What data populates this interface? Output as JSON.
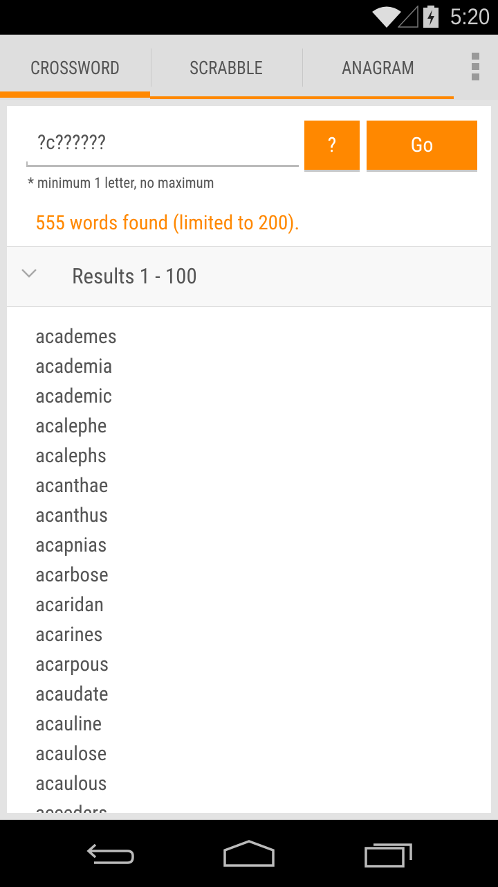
{
  "status_bar": {
    "time": "5:20",
    "icons": [
      "wifi-icon",
      "signal-icon",
      "battery-charging-icon"
    ]
  },
  "tabs": [
    {
      "label": "CROSSWORD",
      "active": true
    },
    {
      "label": "SCRABBLE"
    },
    {
      "label": "ANAGRAM"
    }
  ],
  "search": {
    "value": "?c??????",
    "help_label": "?",
    "go_label": "Go",
    "hint": "* minimum 1 letter, no maximum"
  },
  "result_summary": "555 words found (limited to 200).",
  "results_header": "Results 1 - 100",
  "words": [
    "academes",
    "academia",
    "academic",
    "acalephe",
    "acalephs",
    "acanthae",
    "acanthus",
    "acapnias",
    "acarbose",
    "acaridan",
    "acarines",
    "acarpous",
    "acaudate",
    "acauline",
    "acaulose",
    "acaulous",
    "acceders"
  ],
  "colors": {
    "accent": "#ff8800"
  }
}
